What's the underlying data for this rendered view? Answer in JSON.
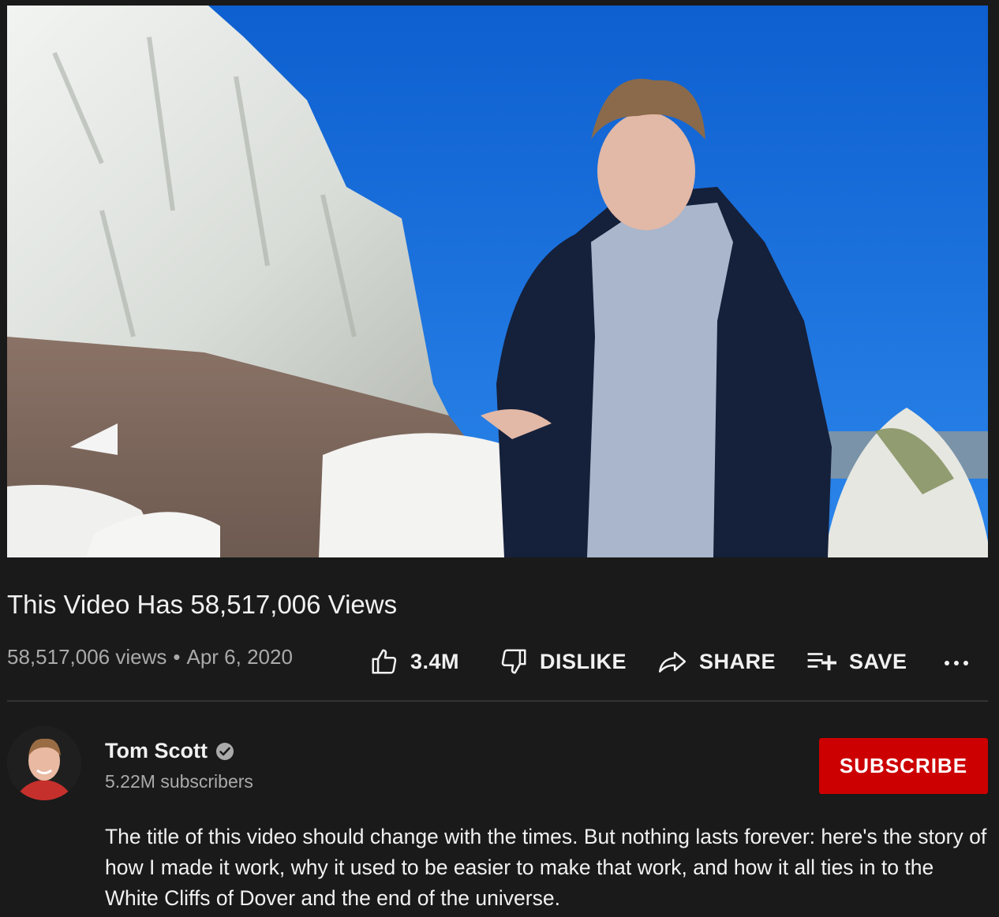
{
  "video": {
    "title": "This Video Has 58,517,006 Views",
    "views": "58,517,006 views",
    "separator": "•",
    "date": "Apr 6, 2020"
  },
  "actions": {
    "like_count": "3.4M",
    "dislike_label": "DISLIKE",
    "share_label": "SHARE",
    "save_label": "SAVE"
  },
  "channel": {
    "name": "Tom Scott",
    "subscribers": "5.22M subscribers",
    "subscribe_label": "SUBSCRIBE"
  },
  "description": "The title of this video should change with the times. But nothing lasts forever: here's the story of how I made it work, why it used to be easier to make that work, and how it all ties in to the White Cliffs of Dover and the end of the universe.",
  "icons": {
    "like": "thumbs-up-icon",
    "dislike": "thumbs-down-icon",
    "share": "share-arrow-icon",
    "save": "playlist-add-icon",
    "more": "more-horizontal-icon",
    "verified": "verified-check-icon"
  },
  "colors": {
    "background": "#1a1a1a",
    "subscribe": "#cc0000",
    "secondary_text": "#aaaaaa",
    "sky": "#1a6fd6"
  }
}
